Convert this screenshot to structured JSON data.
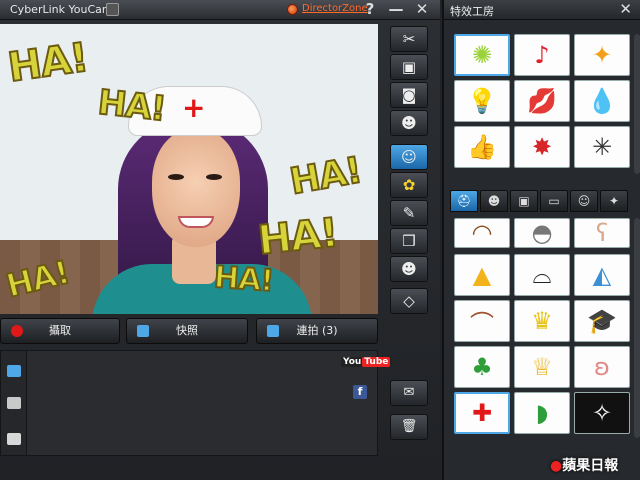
{
  "app": {
    "title": "CyberLink YouCam",
    "director_zone": "DirectorZone",
    "help": "?",
    "minimize": "—",
    "close": "✕"
  },
  "overlay": {
    "ha_text": "HA!"
  },
  "capture": {
    "record": "攝取",
    "snapshot": "快照",
    "burst": "連拍 (3)"
  },
  "gallery": {
    "youtube_you": "You",
    "youtube_tube": "Tube",
    "facebook": "f"
  },
  "effects": {
    "title": "特效工房",
    "close": "✕"
  },
  "watermark": {
    "brand": "蘋果日報"
  },
  "icons": {
    "toolbar": [
      "tools-icon",
      "frame-icon",
      "camera-icon",
      "face-plus-icon",
      "avatar-icon",
      "flower-icon",
      "pencil-icon",
      "stamp-icon",
      "face-swap-icon",
      "eraser-icon"
    ],
    "gallery_side": [
      "person-view-icon",
      "single-view-icon",
      "film-view-icon"
    ],
    "effect_tabs": [
      "hat-tab-icon",
      "face-tab-icon",
      "frame-tab-icon",
      "window-tab-icon",
      "emoticon-tab-icon",
      "magic-tab-icon"
    ]
  },
  "colors": {
    "accent_blue": "#4ea7e6",
    "director_zone_orange": "#ff6a2a",
    "ha_yellow": "#d6d43a",
    "record_red": "#e01818"
  }
}
